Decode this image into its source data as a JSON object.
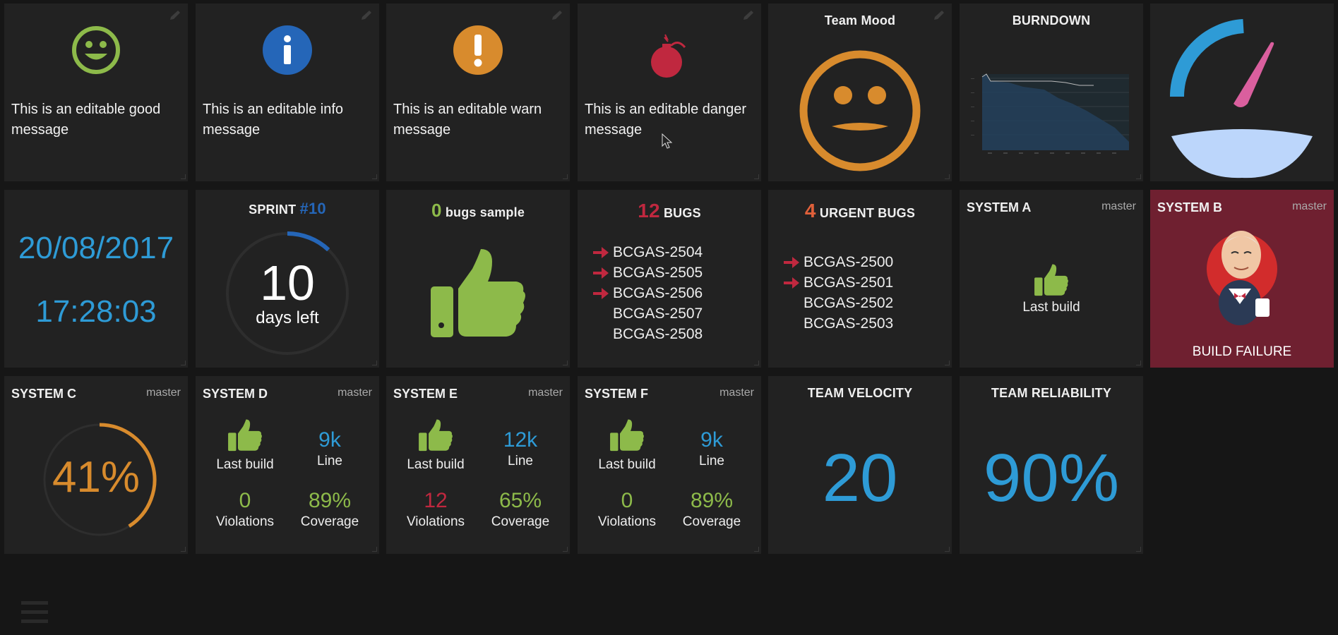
{
  "colors": {
    "good": "#8dba4a",
    "info": "#2566b8",
    "warn": "#d88b2d",
    "danger": "#c0283f",
    "blue": "#2e9bd6",
    "failure_bg": "#6f2030"
  },
  "messages": {
    "good": "This is an editable good message",
    "info": "This is an editable info message",
    "warn": "This is an editable warn message",
    "danger": "This is an editable danger message"
  },
  "team_mood": {
    "title": "Team Mood",
    "mood": "neutral-face-icon"
  },
  "burndown": {
    "title": "BURNDOWN"
  },
  "gauge": {
    "value_fraction": 0.82
  },
  "datetime": {
    "date": "20/08/2017",
    "time": "17:28:03"
  },
  "sprint": {
    "label": "SPRINT",
    "number": "#10",
    "days": "10",
    "days_label": "days left",
    "progress_fraction": 0.12
  },
  "bugs_sample": {
    "count": "0",
    "label": "bugs sample"
  },
  "bugs": {
    "count": "12",
    "label": "BUGS",
    "items": [
      {
        "id": "BCGAS-2504",
        "flag": true
      },
      {
        "id": "BCGAS-2505",
        "flag": true
      },
      {
        "id": "BCGAS-2506",
        "flag": true
      },
      {
        "id": "BCGAS-2507",
        "flag": false
      },
      {
        "id": "BCGAS-2508",
        "flag": false
      }
    ]
  },
  "urgent_bugs": {
    "count": "4",
    "label": "URGENT BUGS",
    "items": [
      {
        "id": "BCGAS-2500",
        "flag": true
      },
      {
        "id": "BCGAS-2501",
        "flag": true
      },
      {
        "id": "BCGAS-2502",
        "flag": false
      },
      {
        "id": "BCGAS-2503",
        "flag": false
      }
    ]
  },
  "system_a": {
    "name": "SYSTEM A",
    "branch": "master",
    "status": "Last build"
  },
  "system_b": {
    "name": "SYSTEM B",
    "branch": "master",
    "status": "BUILD FAILURE"
  },
  "system_c": {
    "name": "SYSTEM C",
    "branch": "master",
    "percent": "41%",
    "fraction": 0.41
  },
  "system_d": {
    "name": "SYSTEM D",
    "branch": "master",
    "build": "Last build",
    "lines": "9k",
    "lines_label": "Line",
    "violations": "0",
    "violations_label": "Violations",
    "coverage": "89%",
    "coverage_label": "Coverage"
  },
  "system_e": {
    "name": "SYSTEM E",
    "branch": "master",
    "build": "Last build",
    "lines": "12k",
    "lines_label": "Line",
    "violations": "12",
    "violations_label": "Violations",
    "coverage": "65%",
    "coverage_label": "Coverage"
  },
  "system_f": {
    "name": "SYSTEM F",
    "branch": "master",
    "build": "Last build",
    "lines": "9k",
    "lines_label": "Line",
    "violations": "0",
    "violations_label": "Violations",
    "coverage": "89%",
    "coverage_label": "Coverage"
  },
  "velocity": {
    "title": "TEAM VELOCITY",
    "value": "20"
  },
  "reliability": {
    "title": "TEAM RELIABILITY",
    "value": "90%"
  },
  "menu": {
    "icon": "hamburger-menu-icon"
  }
}
